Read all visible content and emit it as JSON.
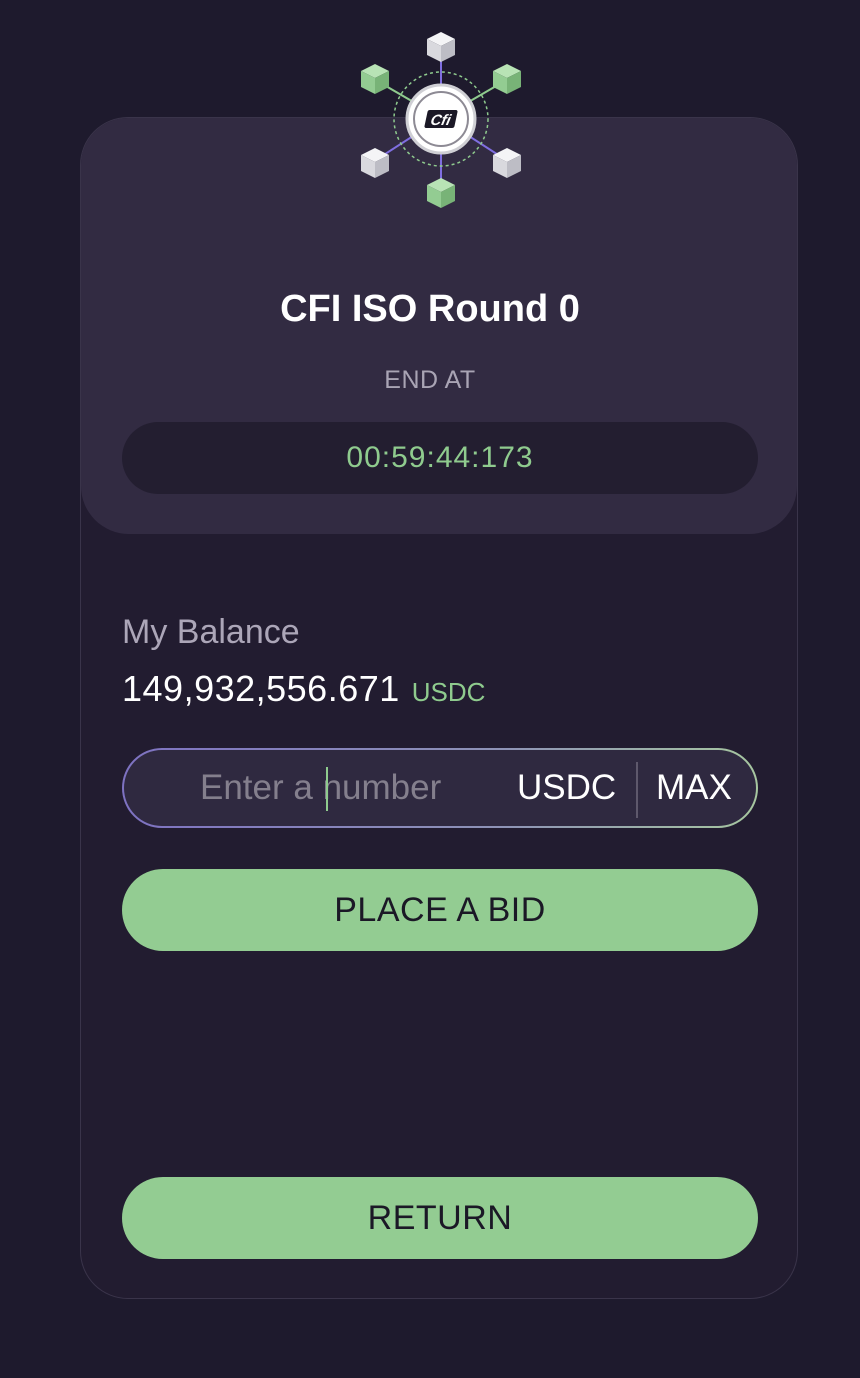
{
  "round": {
    "title": "CFI ISO Round 0",
    "end_label": "END AT",
    "countdown": "00:59:44:173"
  },
  "balance": {
    "label": "My Balance",
    "amount": "149,932,556.671",
    "unit": "USDC"
  },
  "bid_input": {
    "placeholder": "Enter a number",
    "value": "",
    "unit": "USDC",
    "max_label": "MAX"
  },
  "buttons": {
    "place_bid": "PLACE A BID",
    "return": "RETURN"
  },
  "logo": {
    "text": "Cfi"
  },
  "colors": {
    "background": "#1e1a2d",
    "card": "#221c30",
    "card_top": "#322b42",
    "accent_green": "#93cc92",
    "timer_green": "#8fcb8e",
    "purple": "#7e72c2"
  }
}
